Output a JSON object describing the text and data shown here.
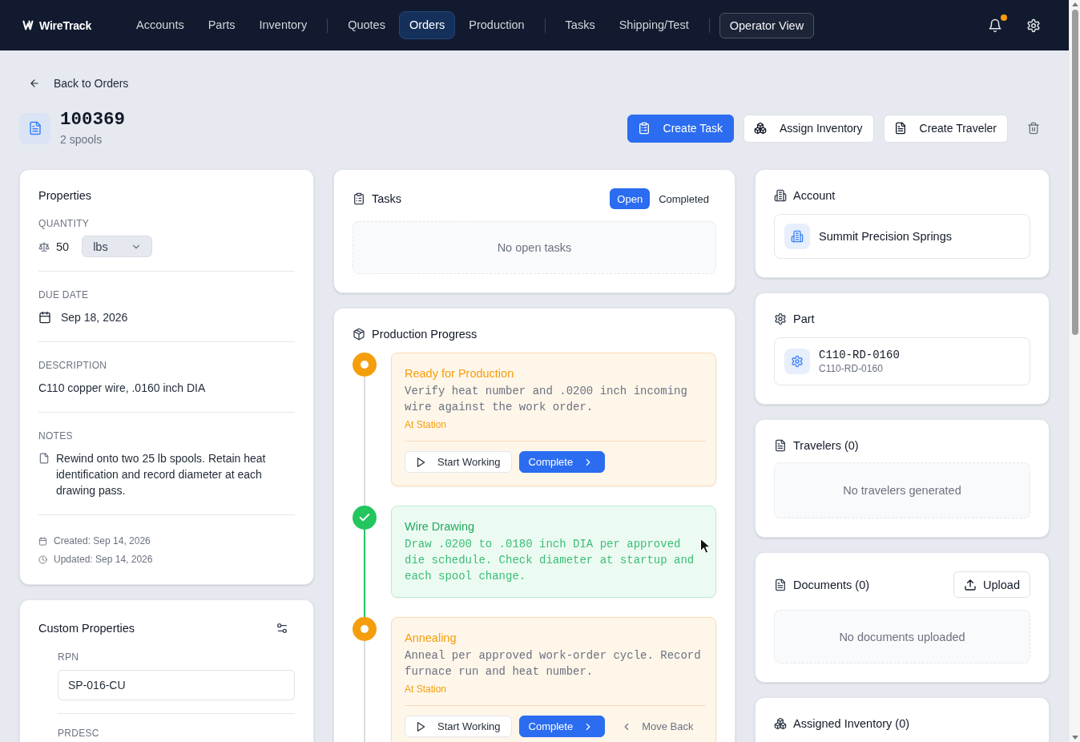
{
  "app": {
    "logo": "WireTrack",
    "nav": [
      {
        "items": [
          {
            "label": "Accounts",
            "selected": false
          },
          {
            "label": "Parts",
            "selected": false
          },
          {
            "label": "Inventory",
            "selected": false
          }
        ]
      },
      {
        "items": [
          {
            "label": "Quotes",
            "selected": false
          },
          {
            "label": "Orders",
            "selected": true
          },
          {
            "label": "Production",
            "selected": false
          }
        ]
      },
      {
        "items": [
          {
            "label": "Tasks",
            "selected": false
          },
          {
            "label": "Shipping/Test",
            "selected": false
          }
        ]
      }
    ],
    "operator_view": "Operator View",
    "notifications": {
      "unread": true
    }
  },
  "header": {
    "back_link": "Back to Orders",
    "order_number": "100369",
    "subtitle": "2 spools",
    "actions": [
      {
        "label": "Create Task",
        "kind": "primary"
      },
      {
        "label": "Assign Inventory",
        "kind": "secondary"
      },
      {
        "label": "Create Traveler",
        "kind": "secondary"
      }
    ]
  },
  "properties": {
    "title": "Properties",
    "quantity": {
      "label": "QUANTITY",
      "value": "50",
      "unit": "lbs"
    },
    "due_date": {
      "label": "DUE DATE",
      "value": "Sep 18, 2026"
    },
    "description": {
      "label": "DESCRIPTION",
      "value": "C110 copper wire, .0160 inch DIA"
    },
    "notes": {
      "label": "NOTES",
      "value": "Rewind onto two 25 lb spools. Retain heat identification and record diameter at each drawing pass."
    },
    "created": "Created: Sep 14, 2026",
    "updated": "Updated: Sep 14, 2026"
  },
  "custom_properties": {
    "title": "Custom Properties",
    "fields": [
      {
        "label": "RPN",
        "value": "SP-016-CU"
      },
      {
        "label": "PRDESC"
      }
    ]
  },
  "tasks": {
    "title": "Tasks",
    "tabs": [
      {
        "label": "Open",
        "selected": true
      },
      {
        "label": "Completed",
        "selected": false
      }
    ],
    "empty": "No open tasks"
  },
  "production": {
    "title": "Production Progress",
    "steps": [
      {
        "completed": false,
        "title": "Ready for Production",
        "description": "Verify heat number and .0200 inch incoming wire against the work order.",
        "location": "At Station",
        "actions": [
          {
            "kind": "start",
            "label": "Start Working"
          },
          {
            "kind": "complete",
            "label": "Complete"
          }
        ]
      },
      {
        "completed": true,
        "title": "Wire Drawing",
        "description": "Draw .0200 to .0180 inch DIA per approved die schedule. Check diameter at startup and each spool change."
      },
      {
        "completed": false,
        "title": "Annealing",
        "description": "Anneal per approved work-order cycle. Record furnace run and heat number.",
        "location": "At Station",
        "actions": [
          {
            "kind": "start",
            "label": "Start Working"
          },
          {
            "kind": "complete",
            "label": "Complete"
          },
          {
            "kind": "back",
            "label": "Move Back"
          }
        ]
      }
    ]
  },
  "account": {
    "title": "Account",
    "name": "Summit Precision Springs"
  },
  "part": {
    "title": "Part",
    "number": "C110-RD-0160",
    "code": "C110-RD-0160"
  },
  "travelers": {
    "title": "Travelers (0)",
    "empty": "No travelers generated"
  },
  "documents": {
    "title": "Documents (0)",
    "upload": "Upload",
    "empty": "No documents uploaded"
  },
  "assigned_inventory": {
    "title": "Assigned Inventory (0)"
  }
}
